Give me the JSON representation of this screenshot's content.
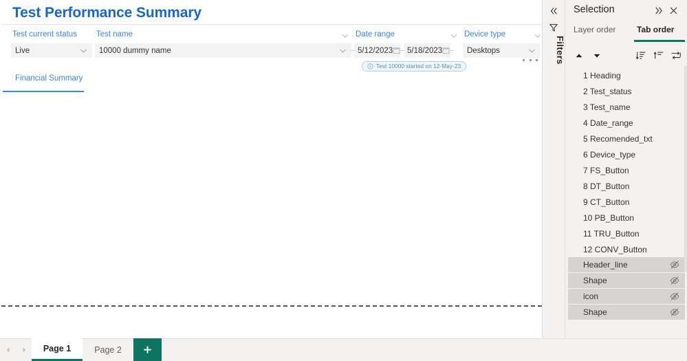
{
  "report": {
    "title": "Test Performance Summary",
    "filters": [
      {
        "id": "test_status",
        "label": "Test current status",
        "value": "Live",
        "type": "dropdown"
      },
      {
        "id": "test_name",
        "label": "Test name",
        "value": "10000 dummy name",
        "type": "dropdown"
      },
      {
        "id": "date_range",
        "label": "Date range",
        "value_from": "5/12/2023",
        "value_to": "5/18/2023",
        "type": "daterange"
      },
      {
        "id": "device_type",
        "label": "Device type",
        "value": "Desktops",
        "type": "dropdown"
      }
    ],
    "info_pill": {
      "icon": "info-icon",
      "text": "Test 10000 started on 12-May-23"
    },
    "section_tab": {
      "label": "Financial Summary"
    },
    "overflow_menu": "..."
  },
  "filters_rail": {
    "collapse_icon": "chevron-double-left-icon",
    "funnel_icon": "funnel-icon",
    "label": "Filters"
  },
  "selection_pane": {
    "title": "Selection",
    "expand_icon": "chevron-double-right-icon",
    "close_icon": "close-icon",
    "tabs": [
      {
        "label": "Layer order",
        "active": false
      },
      {
        "label": "Tab order",
        "active": true
      }
    ],
    "toolbar": [
      {
        "name": "move-up-button",
        "icon": "triangle-up-icon"
      },
      {
        "name": "move-down-button",
        "icon": "triangle-down-icon"
      },
      {
        "name": "sort-list-button",
        "icon": "sort-list-icon"
      },
      {
        "name": "align-top-button",
        "icon": "align-top-icon"
      },
      {
        "name": "tab-order-button",
        "icon": "tab-order-icon"
      }
    ],
    "items": [
      {
        "order": "1",
        "label": "Heading",
        "hidden": false
      },
      {
        "order": "2",
        "label": "Test_status",
        "hidden": false
      },
      {
        "order": "3",
        "label": "Test_name",
        "hidden": false
      },
      {
        "order": "4",
        "label": "Date_range",
        "hidden": false
      },
      {
        "order": "5",
        "label": "Recomended_txt",
        "hidden": false
      },
      {
        "order": "6",
        "label": "Device_type",
        "hidden": false
      },
      {
        "order": "7",
        "label": "FS_Button",
        "hidden": false
      },
      {
        "order": "8",
        "label": "DT_Button",
        "hidden": false
      },
      {
        "order": "9",
        "label": "CT_Button",
        "hidden": false
      },
      {
        "order": "10",
        "label": "PB_Button",
        "hidden": false
      },
      {
        "order": "11",
        "label": "TRU_Button",
        "hidden": false
      },
      {
        "order": "12",
        "label": "CONV_Button",
        "hidden": false
      },
      {
        "order": "",
        "label": "Header_line",
        "hidden": true
      },
      {
        "order": "",
        "label": "Shape",
        "hidden": true
      },
      {
        "order": "",
        "label": "icon",
        "hidden": true
      },
      {
        "order": "",
        "label": "Shape",
        "hidden": true
      }
    ]
  },
  "footer": {
    "prev_icon": "chevron-left-icon",
    "next_icon": "chevron-right-icon",
    "pages": [
      {
        "label": "Page 1",
        "active": true
      },
      {
        "label": "Page 2",
        "active": false
      }
    ],
    "add_page_icon": "plus-icon"
  },
  "colors": {
    "title_blue": "#1966c8",
    "label_blue": "#3a87d8",
    "accent_teal": "#0f7361",
    "pill_border": "#a9d2f0",
    "pill_bg": "#eef7fd",
    "pane_bg": "#f3f2f1",
    "hidden_row_bg": "#d6d4d2"
  }
}
